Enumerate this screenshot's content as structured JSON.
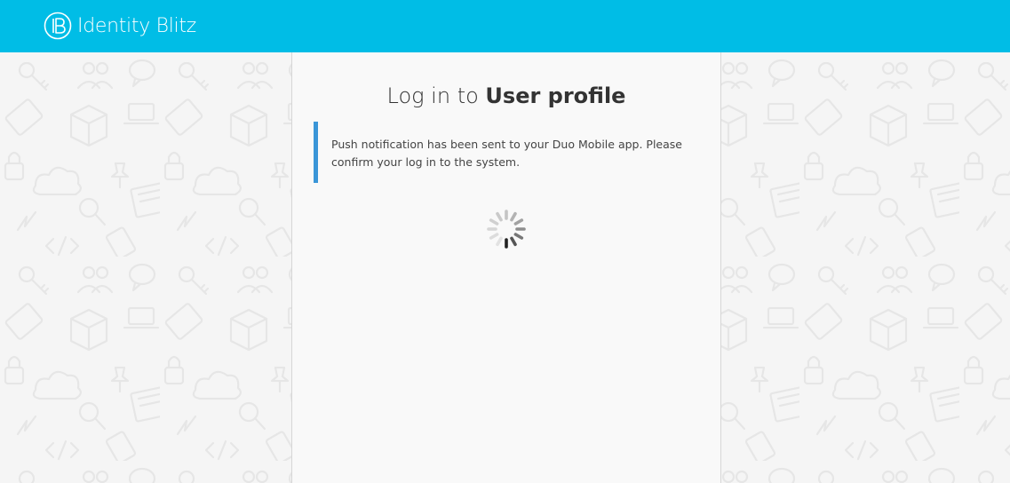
{
  "header": {
    "brand": "Identity Blitz",
    "brand_color": "#00bde6"
  },
  "login": {
    "title_prefix": "Log in to",
    "title_target": "User profile",
    "message": "Push notification has been sent to your Duo Mobile app. Please confirm your log in to the system.",
    "accent_color": "#3a96d8"
  },
  "icons": {
    "logo": "identity-blitz-logo-icon",
    "loading": "loading-spinner-icon"
  }
}
